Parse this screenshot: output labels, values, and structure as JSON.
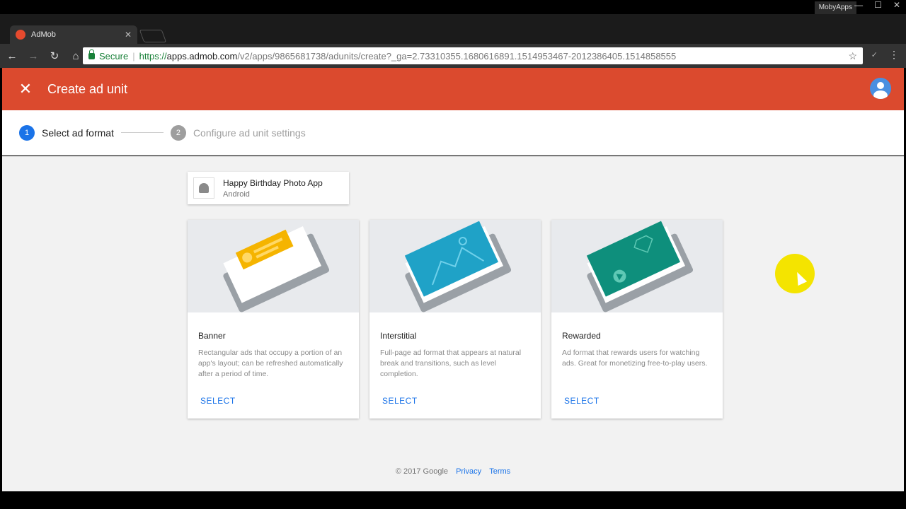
{
  "browser": {
    "tab_title": "AdMob",
    "profile": "MobyApps",
    "url_secure_label": "Secure",
    "url_scheme": "https://",
    "url_host": "apps.admob.com",
    "url_path": "/v2/apps/9865681738/adunits/create?_ga=2.73310355.1680616891.1514953467-2012386405.1514858555"
  },
  "header": {
    "title": "Create ad unit"
  },
  "stepper": {
    "steps": [
      {
        "num": "1",
        "label": "Select ad format"
      },
      {
        "num": "2",
        "label": "Configure ad unit settings"
      }
    ]
  },
  "app": {
    "name": "Happy Birthday Photo App",
    "platform": "Android"
  },
  "cards": [
    {
      "title": "Banner",
      "desc": "Rectangular ads that occupy a portion of an app's layout; can be refreshed automatically after a period of time.",
      "action": "SELECT",
      "color": "#f5b400"
    },
    {
      "title": "Interstitial",
      "desc": "Full-page ad format that appears at natural break and transitions, such as level completion.",
      "action": "SELECT",
      "color": "#1fa2c7"
    },
    {
      "title": "Rewarded",
      "desc": "Ad format that rewards users for watching ads. Great for monetizing free-to-play users.",
      "action": "SELECT",
      "color": "#0e8f7c"
    }
  ],
  "footer": {
    "copyright": "© 2017 Google",
    "privacy": "Privacy",
    "terms": "Terms"
  }
}
